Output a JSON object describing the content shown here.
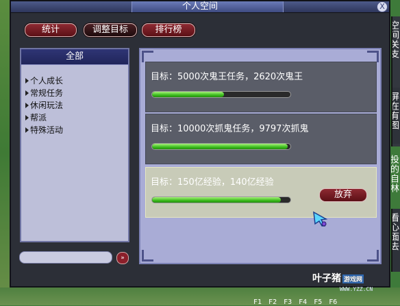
{
  "window": {
    "title": "个人空间",
    "close_label": "X"
  },
  "tabs": [
    {
      "label": "统计"
    },
    {
      "label": "调整目标"
    },
    {
      "label": "排行榜"
    }
  ],
  "categories": {
    "header": "全部",
    "items": [
      {
        "label": "个人成长"
      },
      {
        "label": "常规任务"
      },
      {
        "label": "休闲玩法"
      },
      {
        "label": "帮派"
      },
      {
        "label": "特殊活动"
      }
    ]
  },
  "goals": [
    {
      "text": "目标：5000次鬼王任务，2620次鬼王",
      "progress": 0.52
    },
    {
      "text": "目标：10000次抓鬼任务，9797次抓鬼",
      "progress": 0.98
    },
    {
      "text": "目标：150亿经验，140亿经验",
      "progress": 0.93,
      "action_label": "放弃"
    }
  ],
  "search": {
    "button_label": "»"
  },
  "side_panels": [
    "空间关支",
    "屏在有图",
    "投的自林",
    "看心面去"
  ],
  "hotkeys": [
    "F1",
    "F2",
    "F3",
    "F4",
    "F5",
    "F6"
  ],
  "watermark": {
    "brand": "叶子猪",
    "badge": "游戏网",
    "url": "WWW.YZZ.CN"
  },
  "colors": {
    "window_bg": "#2c2f37",
    "panel_bg": "#a9acd6",
    "button_red": "#8d2a32",
    "progress_green": "#3cbd1e"
  }
}
